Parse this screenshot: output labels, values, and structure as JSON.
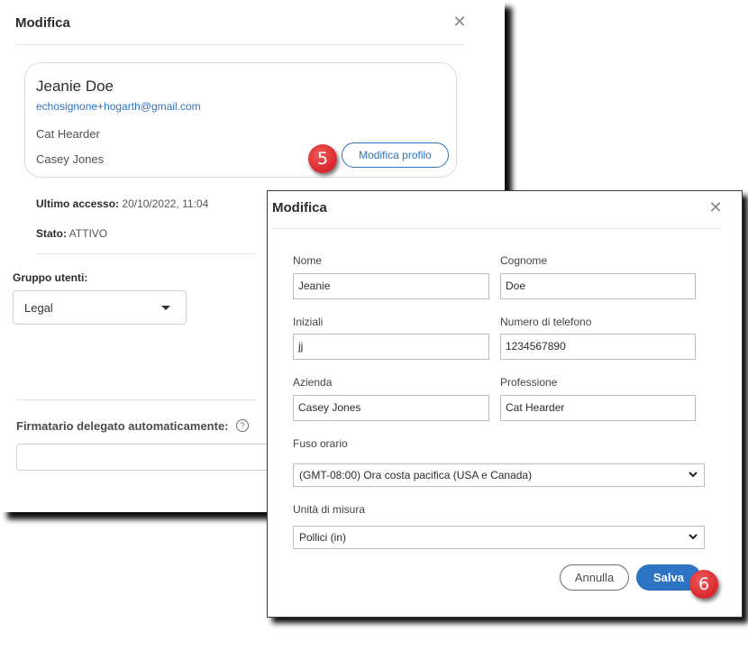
{
  "back_panel": {
    "title": "Modifica",
    "close_icon": "close-icon",
    "profile": {
      "name": "Jeanie Doe",
      "email": "echosignone+hogarth@gmail.com",
      "job_title": "Cat Hearder",
      "company": "Casey Jones",
      "edit_button": "Modifica profilo"
    },
    "last_access_label": "Ultimo accesso:",
    "last_access_value": "20/10/2022, 11:04",
    "status_label": "Stato:",
    "status_value": "ATTIVO",
    "user_group_label": "Gruppo utenti:",
    "user_group_value": "Legal",
    "delegate_label": "Firmatario delegato automaticamente:",
    "help_icon_glyph": "?",
    "delegate_value": ""
  },
  "callouts": {
    "step5": "5",
    "step6": "6"
  },
  "edit_dialog": {
    "title": "Modifica",
    "close_icon": "close-icon",
    "fields": {
      "first_name": {
        "label": "Nome",
        "value": "Jeanie"
      },
      "last_name": {
        "label": "Cognome",
        "value": "Doe"
      },
      "initials": {
        "label": "Iniziali",
        "value": "jj"
      },
      "phone": {
        "label": "Numero di telefono",
        "value": "1234567890"
      },
      "company": {
        "label": "Azienda",
        "value": "Casey Jones"
      },
      "job_title": {
        "label": "Professione",
        "value": "Cat Hearder"
      },
      "timezone": {
        "label": "Fuso orario",
        "value": "(GMT-08:00) Ora costa pacifica (USA e Canada)"
      },
      "units": {
        "label": "Unità di misura",
        "value": "Pollici (in)"
      }
    },
    "cancel_button": "Annulla",
    "save_button": "Salva"
  },
  "colors": {
    "accent": "#2d74c4",
    "callout": "#d8262c"
  }
}
